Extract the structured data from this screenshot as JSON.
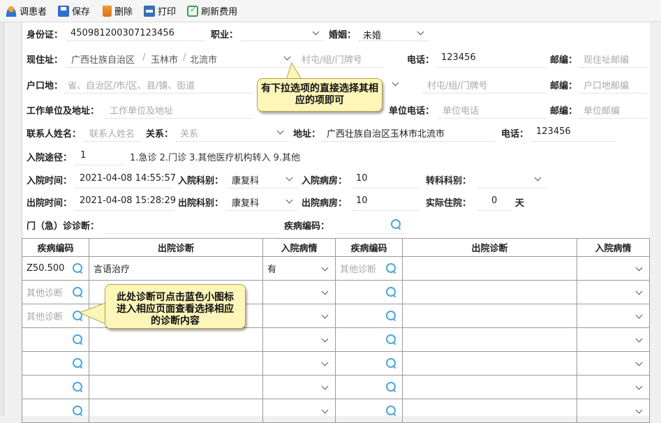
{
  "toolbar": {
    "items": [
      {
        "label": "调患者",
        "icon": "user-icon"
      },
      {
        "label": "保存",
        "icon": "save-icon"
      },
      {
        "label": "删除",
        "icon": "delete-icon"
      },
      {
        "label": "打印",
        "icon": "print-icon"
      },
      {
        "label": "刷新费用",
        "icon": "refresh-icon"
      }
    ]
  },
  "form": {
    "id_label": "身份证：",
    "id_value": "450981200307123456",
    "job_label": "职业：",
    "marriage_label": "婚姻：",
    "marriage_value": "未婚",
    "cur_addr_label": "现住址：",
    "cur_addr_province": "广西壮族自治区",
    "cur_addr_city": "玉林市",
    "cur_addr_county": "北流市",
    "addr_sep": "/",
    "village_placeholder": "村屯/组/门牌号",
    "phone_label": "电话：",
    "phone_value": "123456",
    "postcode_label": "邮编：",
    "cur_postcode_placeholder": "现住址邮编",
    "hukou_label": "户口地：",
    "hukou_placeholder": "省、自治区/市/区、县/镇、街道",
    "hukou_village_placeholder": "村屯/组/门牌号",
    "hukou_postcode_placeholder": "户口地邮编",
    "work_label": "工作单位及地址：",
    "work_placeholder": "工作单位及地址",
    "work_phone_label": "单位电话：",
    "work_phone_placeholder": "单位电话",
    "work_postcode_placeholder": "单位邮编",
    "contact_label": "联系人姓名：",
    "contact_placeholder": "联系人姓名",
    "relation_label": "关系：",
    "relation_placeholder": "关系",
    "contact_addr_label": "地址：",
    "contact_addr_value": "广西壮族自治区玉林市北流市",
    "contact_phone_value": "123456",
    "route_label": "入院途径：",
    "route_value": "1",
    "route_options": "1.急诊  2.门诊  3.其他医疗机构转入  9.其他",
    "admit_time_label": "入院时间：",
    "admit_time_value": "2021-04-08 14:55:57",
    "admit_dept_label": "入院科别：",
    "admit_dept_value": "康复科",
    "admit_ward_label": "入院病房：",
    "admit_ward_value": "10",
    "transfer_label": "转科科别：",
    "discharge_time_label": "出院时间：",
    "discharge_time_value": "2021-04-08 15:28:29",
    "discharge_dept_label": "出院科别：",
    "discharge_dept_value": "康复科",
    "discharge_ward_label": "出院病房：",
    "discharge_ward_value": "10",
    "actual_days_label": "实际住院：",
    "actual_days_value": "0",
    "days_unit": "天",
    "outpatient_label": "门（急）诊诊断：",
    "disease_code_label": "疾病编码："
  },
  "grid": {
    "headers": [
      "疾病编码",
      "出院诊断",
      "入院病情",
      "疾病编码",
      "出院诊断",
      "入院病情"
    ],
    "rows": [
      {
        "code_l": "Z50.500",
        "diag_l": "言语治疗",
        "cond_l": "有",
        "code_r": "其他诊断",
        "code_r_ph": true
      },
      {
        "code_l": "其他诊断",
        "code_l_ph": true,
        "diag_l": "",
        "cond_l": "",
        "code_r": ""
      },
      {
        "code_l": "其他诊断",
        "code_l_ph": true,
        "diag_l": "",
        "cond_l": "",
        "code_r": ""
      },
      {
        "code_l": "",
        "diag_l": "",
        "cond_l": "",
        "code_r": ""
      },
      {
        "code_l": "",
        "diag_l": "",
        "cond_l": "",
        "code_r": ""
      },
      {
        "code_l": "",
        "diag_l": "",
        "cond_l": "",
        "code_r": ""
      },
      {
        "code_l": "",
        "diag_l": "",
        "cond_l": "",
        "code_r": ""
      }
    ]
  },
  "callouts": {
    "top": "有下拉选项的直接选择其相应的项即可",
    "bottom": "此处诊断可点击蓝色小图标进入相应页面查看选择相应的诊断内容"
  }
}
